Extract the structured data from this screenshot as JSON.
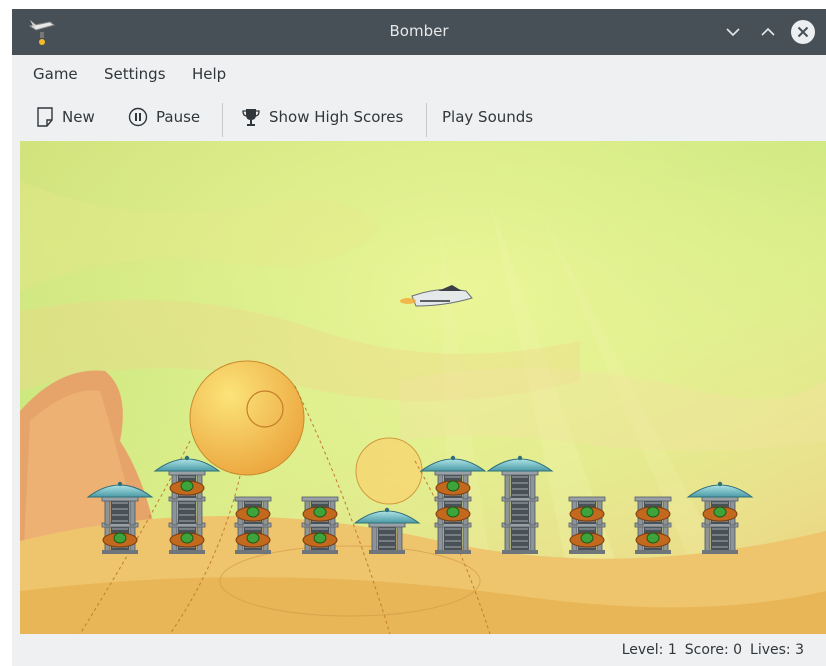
{
  "window": {
    "title": "Bomber"
  },
  "menu": [
    "Game",
    "Settings",
    "Help"
  ],
  "toolbar": {
    "new_label": "New",
    "pause_label": "Pause",
    "high_scores_label": "Show High Scores",
    "sounds_label": "Play Sounds"
  },
  "icons": {
    "new": "document-new-icon",
    "pause": "pause-circle-icon",
    "high_scores": "trophy-icon",
    "minimize": "chevron-down-icon",
    "maximize": "chevron-up-icon",
    "close": "close-circle-icon"
  },
  "game": {
    "building_count": 10
  },
  "status": {
    "level": "Level: 1",
    "score": "Score: 0",
    "lives": "Lives: 3"
  },
  "colors": {
    "titlebar": "#475057",
    "chrome": "#eff0f1",
    "text": "#31363b"
  }
}
